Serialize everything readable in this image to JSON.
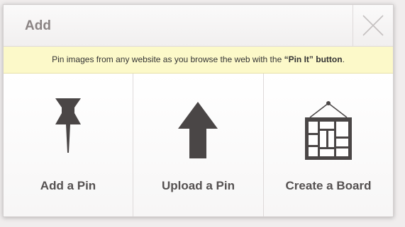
{
  "dialog": {
    "title": "Add",
    "close_icon": "close-icon"
  },
  "notice": {
    "text_before": "Pin images from any website as you browse the web with the ",
    "emphasis": "“Pin It” button",
    "text_after": "."
  },
  "options": [
    {
      "label": "Add a Pin",
      "icon": "pushpin-icon"
    },
    {
      "label": "Upload a Pin",
      "icon": "upload-arrow-icon"
    },
    {
      "label": "Create a Board",
      "icon": "board-frame-icon"
    }
  ],
  "colors": {
    "notice_bg": "#fcf9c9",
    "icon": "#4a4646",
    "label": "#555151",
    "title": "#8a8383"
  }
}
